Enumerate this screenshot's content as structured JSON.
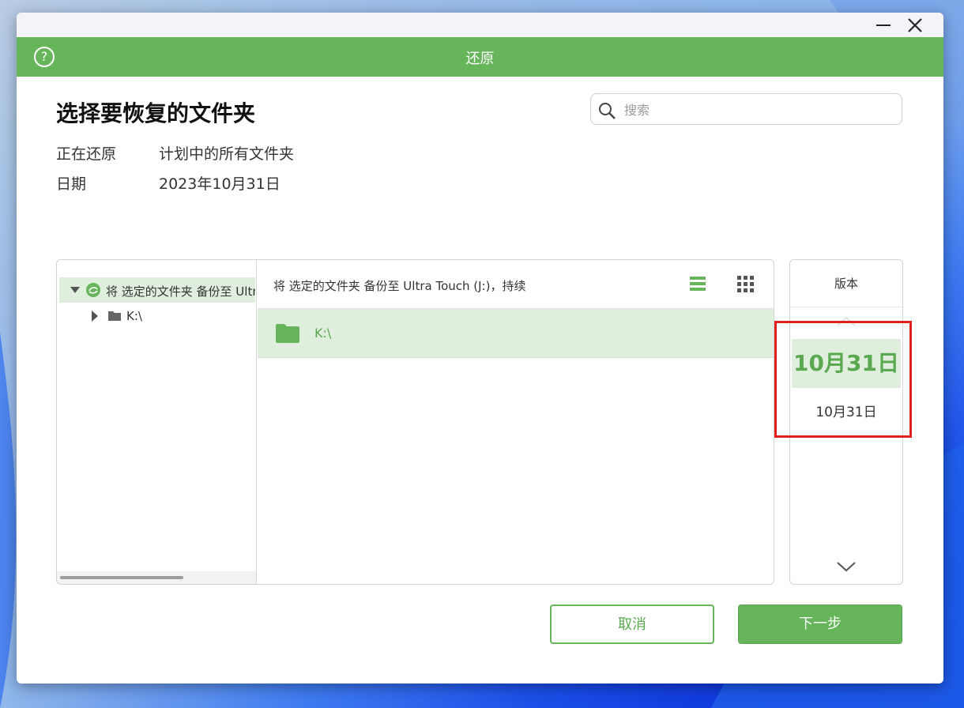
{
  "window": {
    "minimize_label": "—",
    "close_label": "×"
  },
  "header": {
    "title": "还原",
    "help_symbol": "?"
  },
  "page": {
    "title": "选择要恢复的文件夹"
  },
  "search": {
    "placeholder": "搜索"
  },
  "info": {
    "restoring_label": "正在还原",
    "restoring_value": "计划中的所有文件夹",
    "date_label": "日期",
    "date_value": "2023年10月31日"
  },
  "tree": {
    "root_label": "将 选定的文件夹 备份至 Ultra Touch (J:)，持续",
    "child_label": "K:\\"
  },
  "content": {
    "path": "将 选定的文件夹 备份至 Ultra Touch (J:)，持续",
    "files": [
      {
        "name": "K:\\",
        "icon": "folder-icon"
      }
    ]
  },
  "versions": {
    "header": "版本",
    "selected": "10月31日",
    "items": [
      "10月31日"
    ]
  },
  "buttons": {
    "cancel": "取消",
    "next": "下一步"
  },
  "colors": {
    "accent": "#66b55b",
    "selection": "#dfeedd",
    "highlight": "#e0201e"
  }
}
